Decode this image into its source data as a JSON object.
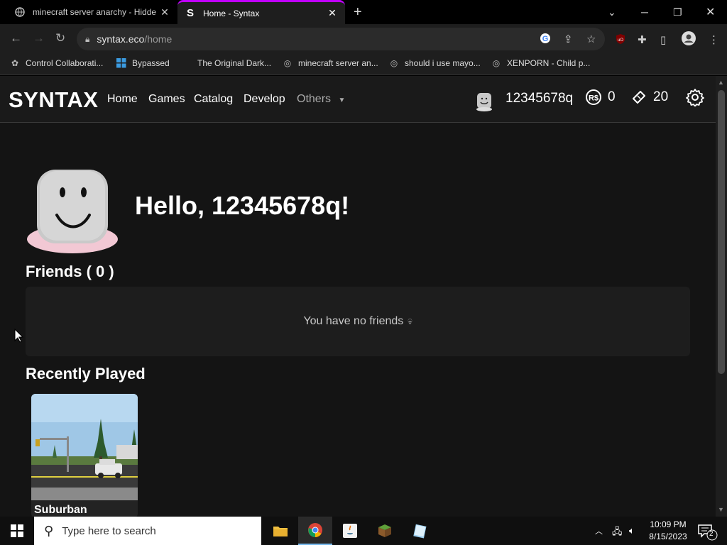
{
  "browser": {
    "tabs": [
      {
        "title": "minecraft server anarchy - Hidde",
        "close": "✕"
      },
      {
        "title": "Home - Syntax",
        "favicon": "S",
        "close": "✕"
      }
    ],
    "url_host": "syntax.eco",
    "url_path": "/home",
    "bookmarks": [
      "Control Collaborati...",
      "Bypassed",
      "The Original Dark...",
      "minecraft server an...",
      "should i use mayo...",
      "XENPORN - Child p..."
    ]
  },
  "site": {
    "logo": "SYNTAX",
    "nav": [
      "Home",
      "Games",
      "Catalog",
      "Develop",
      "Others"
    ],
    "username": "12345678q",
    "robux": "0",
    "tix": "20"
  },
  "home": {
    "greeting": "Hello, 12345678q!",
    "friends_heading": "Friends ( 0 )",
    "no_friends": "You have no friends",
    "recent_heading": "Recently Played",
    "games": [
      {
        "title": "Suburban"
      }
    ]
  },
  "taskbar": {
    "search_placeholder": "Type here to search",
    "time": "10:09 PM",
    "date": "8/15/2023",
    "notifications": "2"
  },
  "colors": {
    "accent_tab": "#c000ff",
    "page_bg": "#141414",
    "nav_bg": "#1a1a1a"
  }
}
